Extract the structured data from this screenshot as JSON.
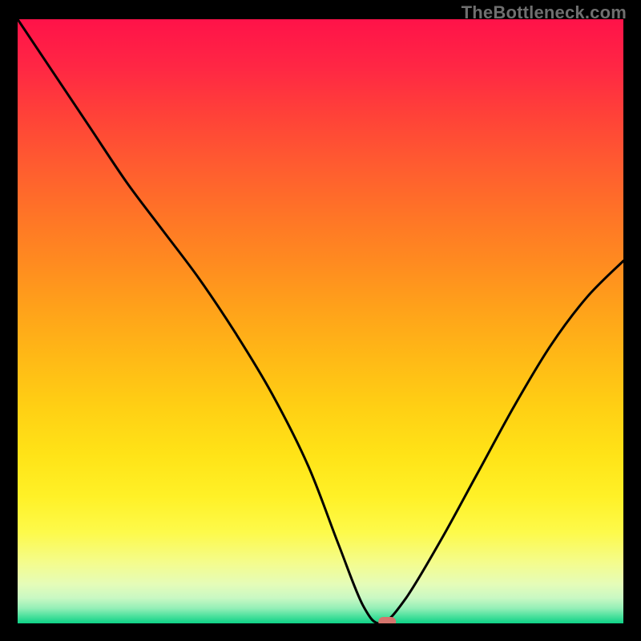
{
  "watermark": {
    "text": "TheBottleneck.com"
  },
  "colors": {
    "frame": "#000000",
    "watermark": "#6f6f6f",
    "curve_stroke": "#000000",
    "marker_fill": "#d5746d",
    "gradient_stops": [
      {
        "offset": 0.0,
        "color": "#ff1249"
      },
      {
        "offset": 0.08,
        "color": "#ff2744"
      },
      {
        "offset": 0.16,
        "color": "#ff4238"
      },
      {
        "offset": 0.24,
        "color": "#ff5b30"
      },
      {
        "offset": 0.32,
        "color": "#ff7327"
      },
      {
        "offset": 0.4,
        "color": "#ff8a20"
      },
      {
        "offset": 0.48,
        "color": "#ffa21a"
      },
      {
        "offset": 0.56,
        "color": "#ffb916"
      },
      {
        "offset": 0.64,
        "color": "#ffcf14"
      },
      {
        "offset": 0.72,
        "color": "#ffe317"
      },
      {
        "offset": 0.79,
        "color": "#fff127"
      },
      {
        "offset": 0.85,
        "color": "#fdfa4b"
      },
      {
        "offset": 0.9,
        "color": "#f4fc8d"
      },
      {
        "offset": 0.935,
        "color": "#e5fcb8"
      },
      {
        "offset": 0.958,
        "color": "#c9f8c3"
      },
      {
        "offset": 0.975,
        "color": "#94efb7"
      },
      {
        "offset": 0.988,
        "color": "#4be19d"
      },
      {
        "offset": 1.0,
        "color": "#0ed186"
      }
    ]
  },
  "chart_data": {
    "type": "line",
    "title": "",
    "xlabel": "",
    "ylabel": "",
    "xlim": [
      0,
      100
    ],
    "ylim": [
      0,
      100
    ],
    "x": [
      0,
      6,
      12,
      18,
      24,
      30,
      36,
      42,
      48,
      53,
      57,
      60,
      64,
      70,
      76,
      82,
      88,
      94,
      100
    ],
    "series": [
      {
        "name": "bottleneck-curve",
        "values": [
          100,
          91,
          82,
          73,
          65,
          57,
          48,
          38,
          26,
          13,
          3,
          0,
          4,
          14,
          25,
          36,
          46,
          54,
          60
        ]
      }
    ],
    "marker": {
      "x": 61,
      "y": 0
    },
    "note": "x is horizontal position in % of plot width (left=0). y is bottleneck in % (0=bottom/green, 100=top/red). Values are estimated from the image."
  }
}
